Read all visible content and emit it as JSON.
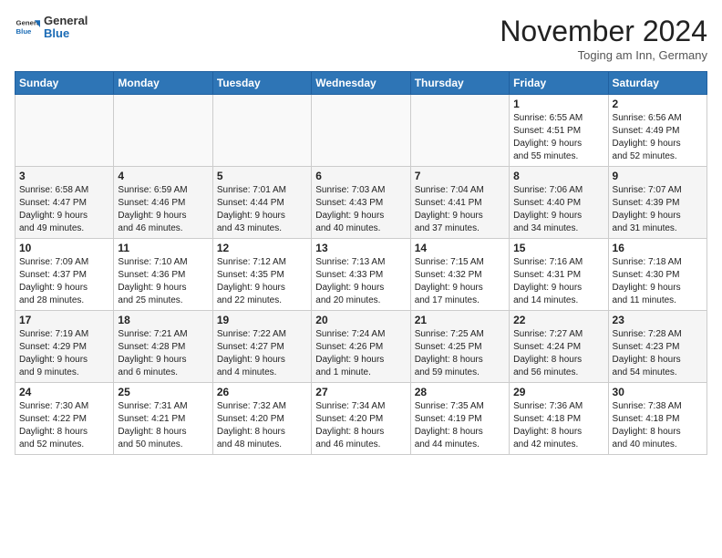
{
  "header": {
    "logo_general": "General",
    "logo_blue": "Blue",
    "month_title": "November 2024",
    "subtitle": "Toging am Inn, Germany"
  },
  "weekdays": [
    "Sunday",
    "Monday",
    "Tuesday",
    "Wednesday",
    "Thursday",
    "Friday",
    "Saturday"
  ],
  "weeks": [
    [
      {
        "day": "",
        "info": ""
      },
      {
        "day": "",
        "info": ""
      },
      {
        "day": "",
        "info": ""
      },
      {
        "day": "",
        "info": ""
      },
      {
        "day": "",
        "info": ""
      },
      {
        "day": "1",
        "info": "Sunrise: 6:55 AM\nSunset: 4:51 PM\nDaylight: 9 hours\nand 55 minutes."
      },
      {
        "day": "2",
        "info": "Sunrise: 6:56 AM\nSunset: 4:49 PM\nDaylight: 9 hours\nand 52 minutes."
      }
    ],
    [
      {
        "day": "3",
        "info": "Sunrise: 6:58 AM\nSunset: 4:47 PM\nDaylight: 9 hours\nand 49 minutes."
      },
      {
        "day": "4",
        "info": "Sunrise: 6:59 AM\nSunset: 4:46 PM\nDaylight: 9 hours\nand 46 minutes."
      },
      {
        "day": "5",
        "info": "Sunrise: 7:01 AM\nSunset: 4:44 PM\nDaylight: 9 hours\nand 43 minutes."
      },
      {
        "day": "6",
        "info": "Sunrise: 7:03 AM\nSunset: 4:43 PM\nDaylight: 9 hours\nand 40 minutes."
      },
      {
        "day": "7",
        "info": "Sunrise: 7:04 AM\nSunset: 4:41 PM\nDaylight: 9 hours\nand 37 minutes."
      },
      {
        "day": "8",
        "info": "Sunrise: 7:06 AM\nSunset: 4:40 PM\nDaylight: 9 hours\nand 34 minutes."
      },
      {
        "day": "9",
        "info": "Sunrise: 7:07 AM\nSunset: 4:39 PM\nDaylight: 9 hours\nand 31 minutes."
      }
    ],
    [
      {
        "day": "10",
        "info": "Sunrise: 7:09 AM\nSunset: 4:37 PM\nDaylight: 9 hours\nand 28 minutes."
      },
      {
        "day": "11",
        "info": "Sunrise: 7:10 AM\nSunset: 4:36 PM\nDaylight: 9 hours\nand 25 minutes."
      },
      {
        "day": "12",
        "info": "Sunrise: 7:12 AM\nSunset: 4:35 PM\nDaylight: 9 hours\nand 22 minutes."
      },
      {
        "day": "13",
        "info": "Sunrise: 7:13 AM\nSunset: 4:33 PM\nDaylight: 9 hours\nand 20 minutes."
      },
      {
        "day": "14",
        "info": "Sunrise: 7:15 AM\nSunset: 4:32 PM\nDaylight: 9 hours\nand 17 minutes."
      },
      {
        "day": "15",
        "info": "Sunrise: 7:16 AM\nSunset: 4:31 PM\nDaylight: 9 hours\nand 14 minutes."
      },
      {
        "day": "16",
        "info": "Sunrise: 7:18 AM\nSunset: 4:30 PM\nDaylight: 9 hours\nand 11 minutes."
      }
    ],
    [
      {
        "day": "17",
        "info": "Sunrise: 7:19 AM\nSunset: 4:29 PM\nDaylight: 9 hours\nand 9 minutes."
      },
      {
        "day": "18",
        "info": "Sunrise: 7:21 AM\nSunset: 4:28 PM\nDaylight: 9 hours\nand 6 minutes."
      },
      {
        "day": "19",
        "info": "Sunrise: 7:22 AM\nSunset: 4:27 PM\nDaylight: 9 hours\nand 4 minutes."
      },
      {
        "day": "20",
        "info": "Sunrise: 7:24 AM\nSunset: 4:26 PM\nDaylight: 9 hours\nand 1 minute."
      },
      {
        "day": "21",
        "info": "Sunrise: 7:25 AM\nSunset: 4:25 PM\nDaylight: 8 hours\nand 59 minutes."
      },
      {
        "day": "22",
        "info": "Sunrise: 7:27 AM\nSunset: 4:24 PM\nDaylight: 8 hours\nand 56 minutes."
      },
      {
        "day": "23",
        "info": "Sunrise: 7:28 AM\nSunset: 4:23 PM\nDaylight: 8 hours\nand 54 minutes."
      }
    ],
    [
      {
        "day": "24",
        "info": "Sunrise: 7:30 AM\nSunset: 4:22 PM\nDaylight: 8 hours\nand 52 minutes."
      },
      {
        "day": "25",
        "info": "Sunrise: 7:31 AM\nSunset: 4:21 PM\nDaylight: 8 hours\nand 50 minutes."
      },
      {
        "day": "26",
        "info": "Sunrise: 7:32 AM\nSunset: 4:20 PM\nDaylight: 8 hours\nand 48 minutes."
      },
      {
        "day": "27",
        "info": "Sunrise: 7:34 AM\nSunset: 4:20 PM\nDaylight: 8 hours\nand 46 minutes."
      },
      {
        "day": "28",
        "info": "Sunrise: 7:35 AM\nSunset: 4:19 PM\nDaylight: 8 hours\nand 44 minutes."
      },
      {
        "day": "29",
        "info": "Sunrise: 7:36 AM\nSunset: 4:18 PM\nDaylight: 8 hours\nand 42 minutes."
      },
      {
        "day": "30",
        "info": "Sunrise: 7:38 AM\nSunset: 4:18 PM\nDaylight: 8 hours\nand 40 minutes."
      }
    ]
  ]
}
